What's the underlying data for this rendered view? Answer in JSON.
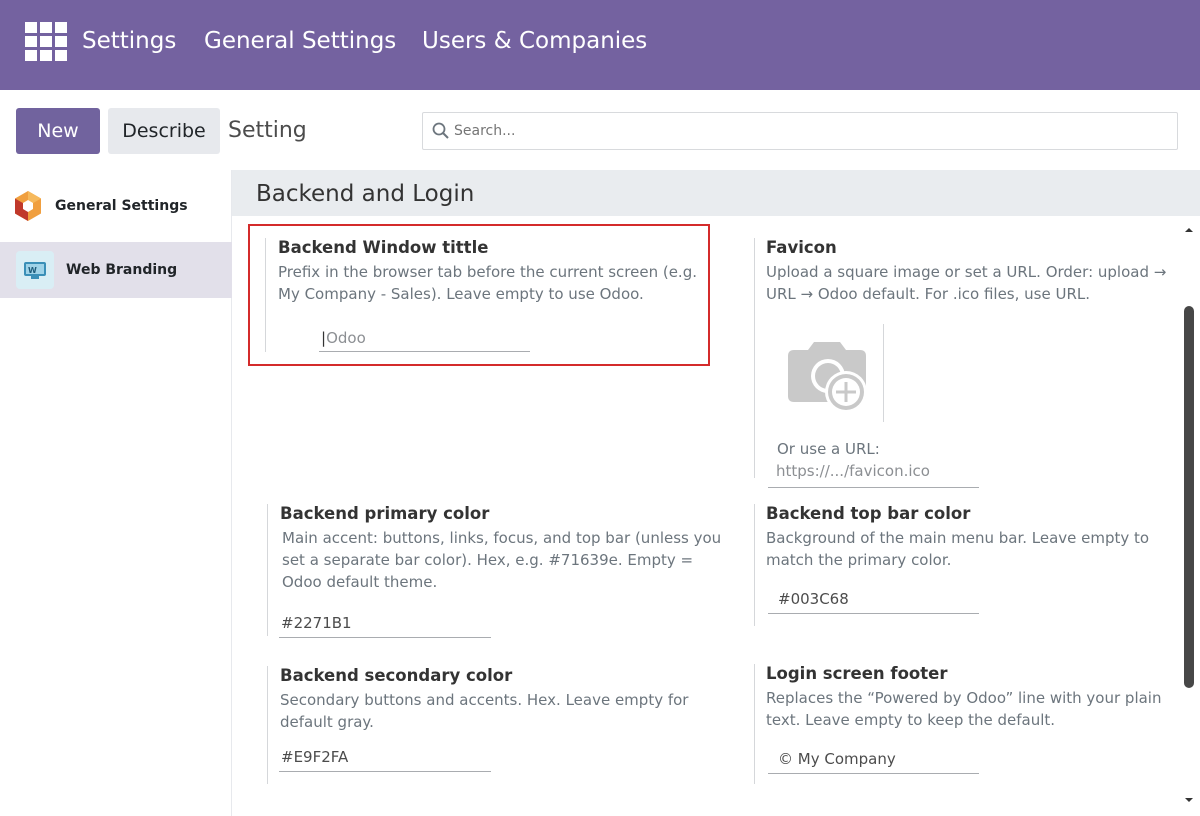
{
  "topbar": {
    "apps_icon": "apps-grid-icon",
    "nav": [
      "Settings",
      "General Settings",
      "Users & Companies"
    ]
  },
  "control": {
    "new_label": "New",
    "describe_label": "Describe",
    "breadcrumb": "Setting",
    "search_placeholder": "Search..."
  },
  "sidebar": {
    "items": [
      {
        "label": "General Settings",
        "icon": "odoo-hexagon-icon"
      },
      {
        "label": "Web Branding",
        "icon": "web-branding-icon"
      }
    ]
  },
  "section": {
    "title": "Backend and Login"
  },
  "settings": {
    "window_title": {
      "title": "Backend Window tittle",
      "desc": "Prefix in the browser tab before the current screen (e.g. My Company - Sales). Leave empty to use Odoo.",
      "placeholder": "Odoo"
    },
    "favicon": {
      "title": "Favicon",
      "desc": "Upload a square image or set a URL. Order: upload → URL → Odoo default. For .ico files, use URL.",
      "url_label": "Or use a URL:",
      "url_placeholder": "https://.../favicon.ico"
    },
    "primary_color": {
      "title": "Backend primary color",
      "desc": "Main accent: buttons, links, focus, and top bar (unless you set a separate bar color). Hex, e.g. #71639e. Empty = Odoo default theme.",
      "value": "#2271B1"
    },
    "top_bar_color": {
      "title": "Backend top bar color",
      "desc": "Background of the main menu bar. Leave empty to match the primary color.",
      "value": "#003C68"
    },
    "secondary_color": {
      "title": "Backend secondary color",
      "desc": "Secondary buttons and accents. Hex. Leave empty for default gray.",
      "value": "#E9F2FA"
    },
    "login_footer": {
      "title": "Login screen footer",
      "desc": "Replaces the “Powered by Odoo” line with your plain text. Leave empty to keep the default.",
      "value": "© My Company"
    }
  },
  "colors": {
    "topbar": "#7462a0",
    "primary_button": "#71639e",
    "highlight": "#d42b2b"
  }
}
